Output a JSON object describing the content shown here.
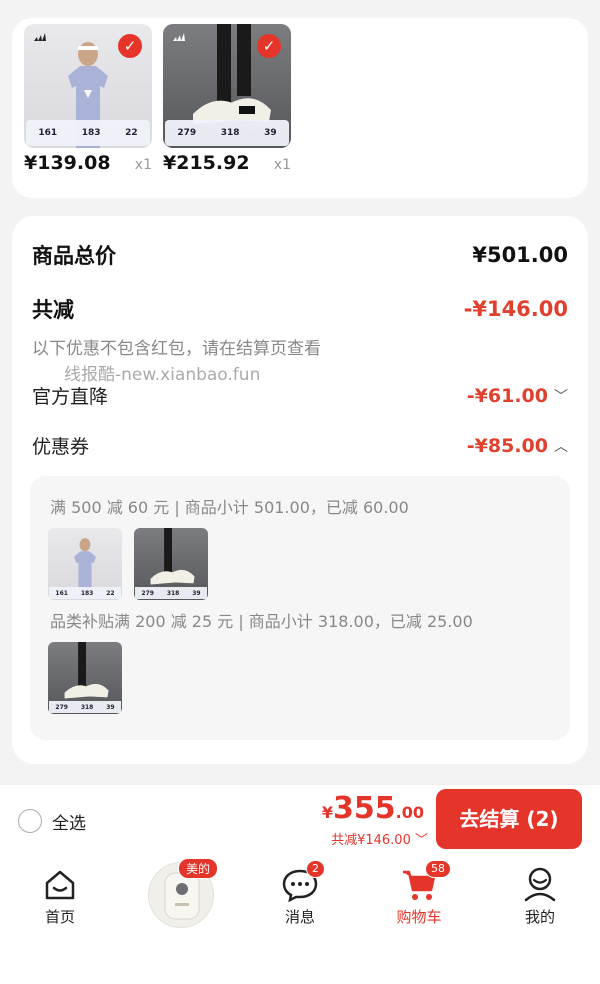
{
  "products": [
    {
      "price": "¥139.08",
      "qty": "x1",
      "stats": [
        "161",
        "183",
        "22"
      ]
    },
    {
      "price": "¥215.92",
      "qty": "x1",
      "stats": [
        "279",
        "318",
        "39"
      ]
    }
  ],
  "summary": {
    "total_label": "商品总价",
    "total_value": "¥501.00",
    "reduce_label": "共减",
    "reduce_value": "-¥146.00",
    "note": "以下优惠不包含红包，请在结算页查看",
    "watermark": "线报酷-new.xianbao.fun",
    "official_label": "官方直降",
    "official_value": "-¥61.00",
    "coupon_label": "优惠券",
    "coupon_value": "-¥85.00"
  },
  "coupons": [
    {
      "text": "满 500 减 60 元 | 商品小计 501.00，已减 60.00",
      "thumbs": [
        {
          "stats": [
            "161",
            "183",
            "22"
          ]
        },
        {
          "stats": [
            "279",
            "318",
            "39"
          ]
        }
      ]
    },
    {
      "text": "品类补贴满 200 减 25 元 | 商品小计 318.00，已减 25.00",
      "thumbs": [
        {
          "stats": [
            "279",
            "318",
            "39"
          ]
        }
      ]
    }
  ],
  "checkout": {
    "select_all": "全选",
    "currency": "¥",
    "amount_int": "355",
    "amount_dec": ".00",
    "reduce_text": "共减¥146.00",
    "button": "去结算 (2)"
  },
  "tabs": [
    {
      "label": "首页"
    },
    {
      "promo_tag": "美的"
    },
    {
      "label": "消息",
      "badge": "2"
    },
    {
      "label": "购物车",
      "badge": "58"
    },
    {
      "label": "我的"
    }
  ],
  "colors": {
    "accent": "#e5352b",
    "price_red": "#e0412f"
  }
}
